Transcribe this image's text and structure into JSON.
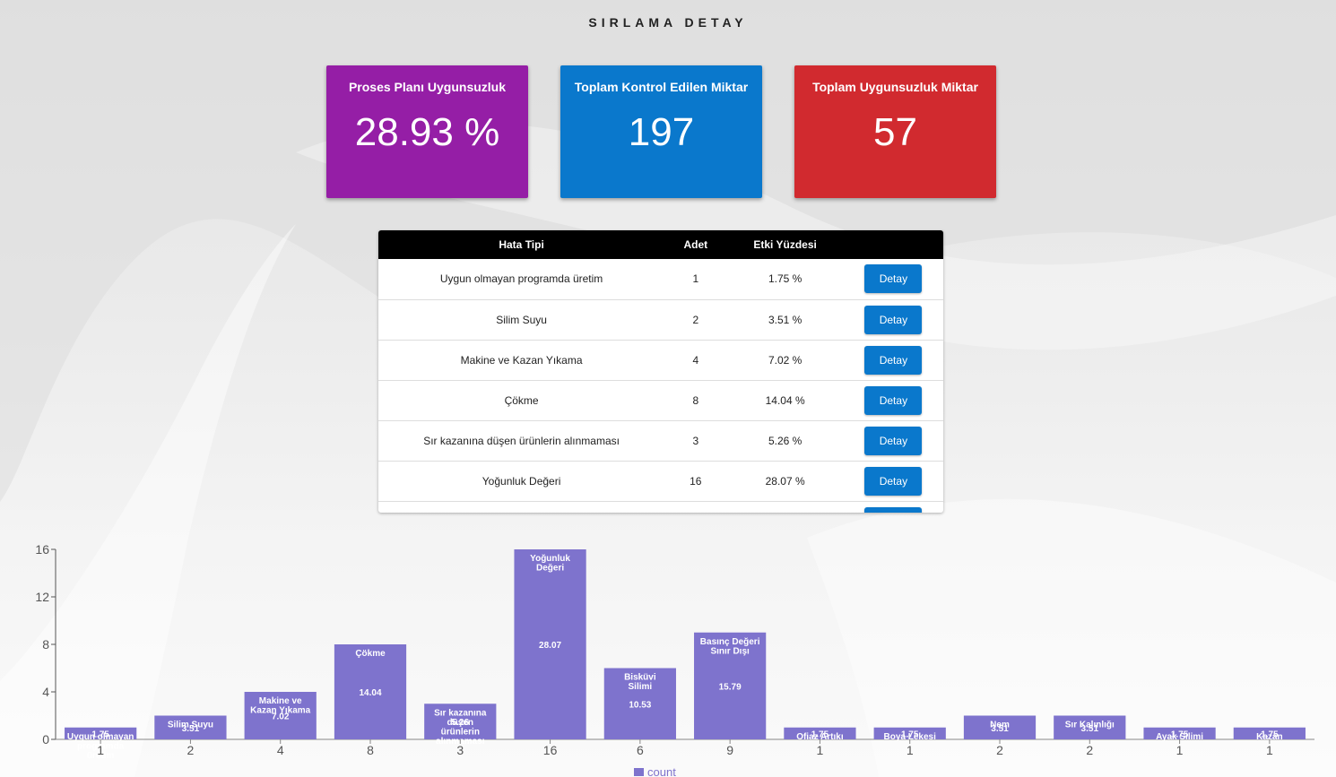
{
  "page": {
    "title": "SIRLAMA DETAY"
  },
  "cards": [
    {
      "label": "Proses Planı Uygunsuzluk",
      "value": "28.93 %",
      "color": "#951ea6"
    },
    {
      "label": "Toplam Kontrol Edilen Miktar",
      "value": "197",
      "color": "#0a78cc"
    },
    {
      "label": "Toplam Uygunsuzluk Miktar",
      "value": "57",
      "color": "#d12a2f"
    }
  ],
  "table": {
    "headers": [
      "Hata Tipi",
      "Adet",
      "Etki Yüzdesi",
      ""
    ],
    "button_label": "Detay",
    "rows": [
      {
        "type": "Uygun olmayan programda üretim",
        "count": "1",
        "pct": "1.75 %"
      },
      {
        "type": "Silim Suyu",
        "count": "2",
        "pct": "3.51 %"
      },
      {
        "type": "Makine ve Kazan Yıkama",
        "count": "4",
        "pct": "7.02 %"
      },
      {
        "type": "Çökme",
        "count": "8",
        "pct": "14.04 %"
      },
      {
        "type": "Sır kazanına düşen ürünlerin alınmaması",
        "count": "3",
        "pct": "5.26 %"
      },
      {
        "type": "Yoğunluk Değeri",
        "count": "16",
        "pct": "28.07 %"
      },
      {
        "type": "",
        "count": "",
        "pct": ""
      }
    ]
  },
  "chart_data": {
    "type": "bar",
    "color": "#7e73cd",
    "ylim": [
      0,
      16
    ],
    "yticks": [
      0,
      4,
      8,
      12,
      16
    ],
    "legend": "count",
    "categories": [
      {
        "label": "Uygun olmayan programda üretim",
        "count": 1,
        "pct": "1.75",
        "tick": "1"
      },
      {
        "label": "Silim Suyu",
        "count": 2,
        "pct": "3.51",
        "tick": "2"
      },
      {
        "label": "Makine ve Kazan Yıkama",
        "count": 4,
        "pct": "7.02",
        "tick": "4"
      },
      {
        "label": "Çökme",
        "count": 8,
        "pct": "14.04",
        "tick": "8"
      },
      {
        "label": "Sır kazanına düşen ürünlerin alınmaması",
        "count": 3,
        "pct": "5.26",
        "tick": "3"
      },
      {
        "label": "Yoğunluk Değeri",
        "count": 16,
        "pct": "28.07",
        "tick": "16"
      },
      {
        "label": "Bisküvi Silimi",
        "count": 6,
        "pct": "10.53",
        "tick": "6"
      },
      {
        "label": "Basınç Değeri Sınır Dışı",
        "count": 9,
        "pct": "15.79",
        "tick": "9"
      },
      {
        "label": "Ofiaz Artıkı",
        "count": 1,
        "pct": "1.75",
        "tick": "1"
      },
      {
        "label": "Boya Lekesi",
        "count": 1,
        "pct": "1.75",
        "tick": "1"
      },
      {
        "label": "Nem",
        "count": 2,
        "pct": "3.51",
        "tick": "2"
      },
      {
        "label": "Sır Kalınlığı",
        "count": 2,
        "pct": "3.51",
        "tick": "2"
      },
      {
        "label": "Ayak Silimi",
        "count": 1,
        "pct": "1.75",
        "tick": "1"
      },
      {
        "label": "Kazan",
        "count": 1,
        "pct": "1.75",
        "tick": "1"
      }
    ]
  }
}
